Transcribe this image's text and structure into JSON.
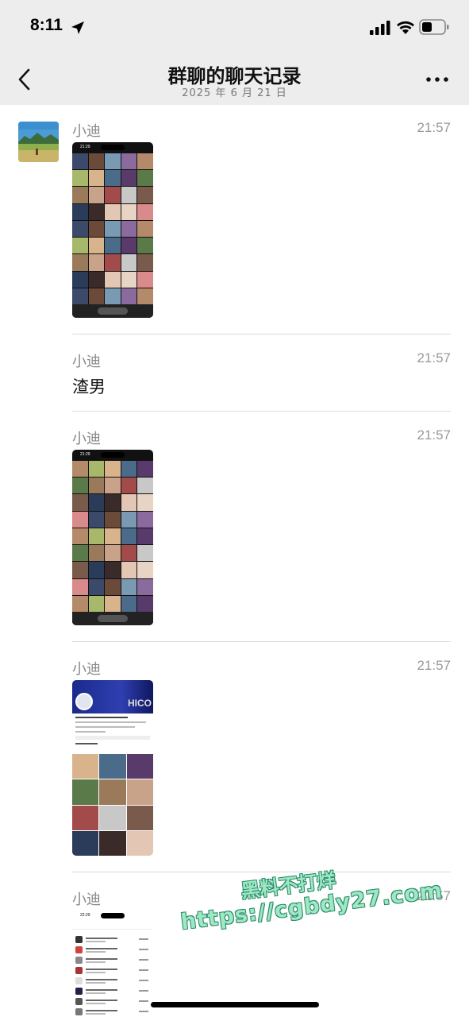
{
  "status_bar": {
    "time": "8:11",
    "icons": [
      "location-arrow-icon",
      "cellular-signal-icon",
      "wifi-icon",
      "battery-icon"
    ]
  },
  "nav": {
    "title": "群聊的聊天记录",
    "subtitle": "2025 年 6 月 21 日",
    "back_icon": "chevron-left-icon",
    "more_icon": "ellipsis-icon"
  },
  "messages": [
    {
      "sender": "小迪",
      "time": "21:57",
      "type": "image",
      "image_desc": "photo-grid-screenshot"
    },
    {
      "sender": "小迪",
      "time": "21:57",
      "type": "text",
      "text": "渣男"
    },
    {
      "sender": "小迪",
      "time": "21:57",
      "type": "image",
      "image_desc": "photo-grid-screenshot"
    },
    {
      "sender": "小迪",
      "time": "21:57",
      "type": "image",
      "image_desc": "profile-screenshot"
    },
    {
      "sender": "小迪",
      "time": "21:57",
      "type": "image",
      "image_desc": "contact-list-screenshot"
    }
  ],
  "watermark": {
    "line1": "黑料不打烊",
    "line2": "https://cgbdy27.com"
  },
  "colors": {
    "header_bg": "#ededed",
    "background": "#ffffff",
    "sender_text": "#888888",
    "time_text": "#999999",
    "watermark": "#9ee8c4"
  }
}
